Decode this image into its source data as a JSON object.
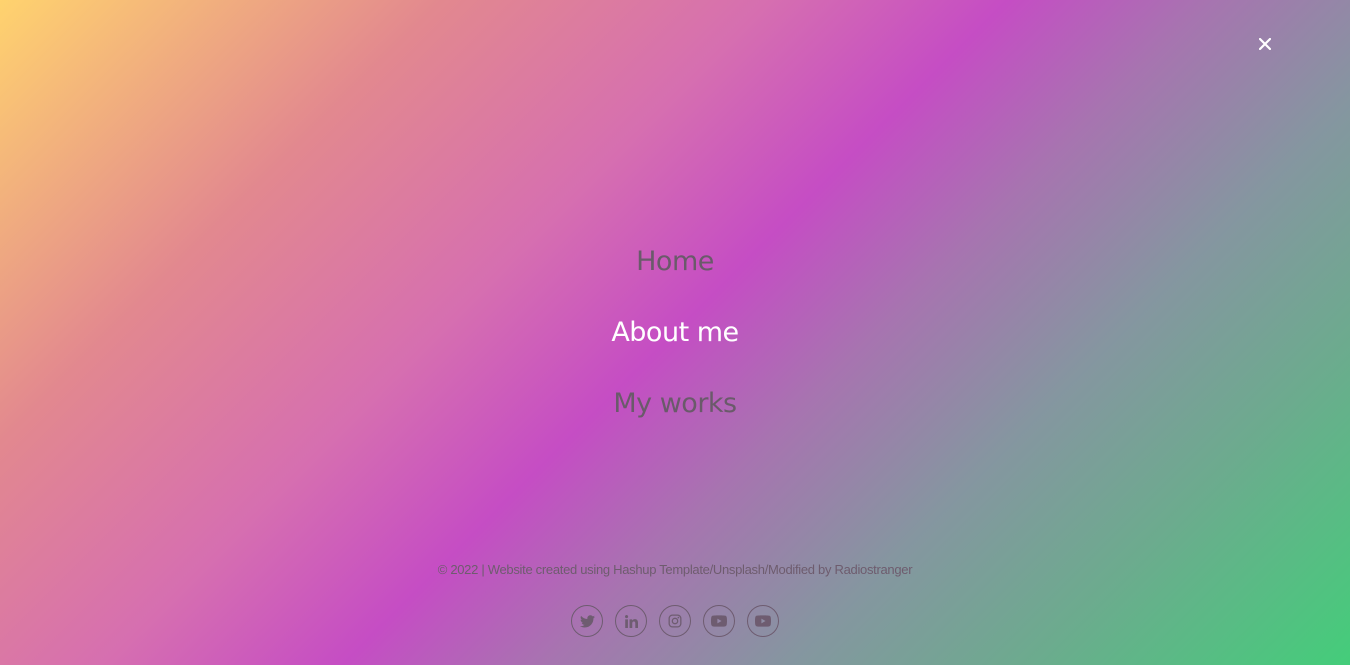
{
  "menu": {
    "items": [
      {
        "label": "Home",
        "active": false
      },
      {
        "label": "About me",
        "active": true
      },
      {
        "label": "My works",
        "active": false
      }
    ]
  },
  "footer": {
    "copyright": "© 2022 | Website created using Hashup Template/Unsplash/Modified by Radiostranger"
  },
  "social": [
    "twitter-icon",
    "linkedin-icon",
    "instagram-icon",
    "youtube-icon",
    "youtube-icon"
  ],
  "colors": {
    "gradient": [
      "#ffd36e",
      "#c54dc4",
      "#44cd7a"
    ],
    "nav_text": "#6a5a6a",
    "nav_active": "#ffffff"
  }
}
